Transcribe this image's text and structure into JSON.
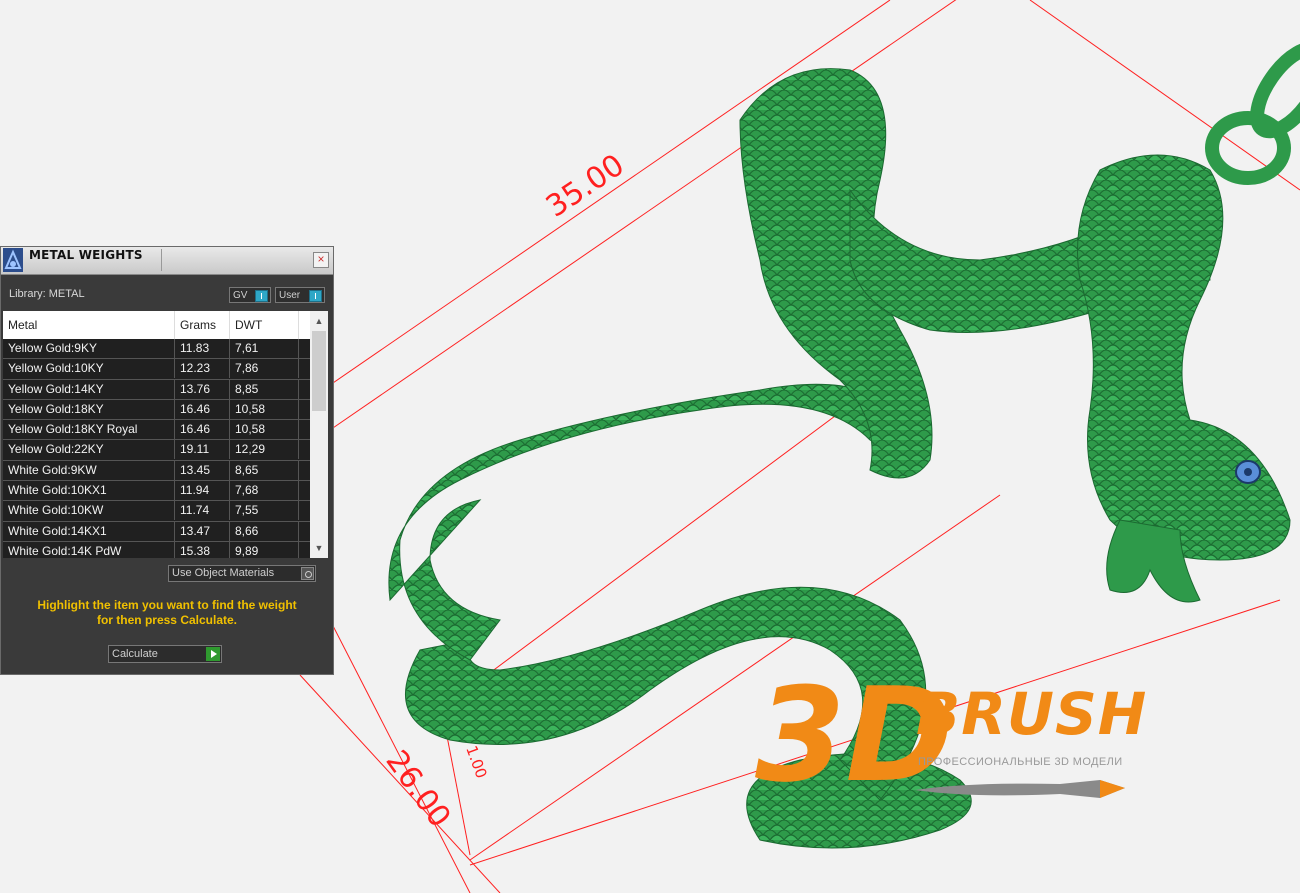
{
  "panel": {
    "title": "METAL WEIGHTS",
    "close": "×",
    "library_label": "Library: METAL",
    "toggles": {
      "gv": "GV",
      "user": "User"
    },
    "columns": [
      "Metal",
      "Grams",
      "DWT"
    ],
    "rows": [
      {
        "metal": "Yellow Gold:9KY",
        "grams": "11.83",
        "dwt": "7,61"
      },
      {
        "metal": "Yellow Gold:10KY",
        "grams": "12.23",
        "dwt": "7,86"
      },
      {
        "metal": "Yellow Gold:14KY",
        "grams": "13.76",
        "dwt": "8,85"
      },
      {
        "metal": "Yellow Gold:18KY",
        "grams": "16.46",
        "dwt": "10,58"
      },
      {
        "metal": "Yellow Gold:18KY Royal",
        "grams": "16.46",
        "dwt": "10,58"
      },
      {
        "metal": "Yellow Gold:22KY",
        "grams": "19.11",
        "dwt": "12,29"
      },
      {
        "metal": "White Gold:9KW",
        "grams": "13.45",
        "dwt": "8,65"
      },
      {
        "metal": "White Gold:10KX1",
        "grams": "11.94",
        "dwt": "7,68"
      },
      {
        "metal": "White Gold:10KW",
        "grams": "11.74",
        "dwt": "7,55"
      },
      {
        "metal": "White Gold:14KX1",
        "grams": "13.47",
        "dwt": "8,66"
      },
      {
        "metal": "White Gold:14K PdW",
        "grams": "15.38",
        "dwt": "9,89"
      }
    ],
    "use_object_materials": "Use Object Materials",
    "hint_line1": "Highlight the item you want to find the weight",
    "hint_line2": "for then press Calculate.",
    "calculate": "Calculate",
    "accent_color": "#f0c000"
  },
  "viewport": {
    "dimensions": [
      "35.00",
      "26.00",
      "1.00"
    ],
    "model_color": "#2e9a4a",
    "dimension_color": "#ff2020"
  },
  "logo": {
    "brand_3d": "3D",
    "brand": "BRUSH",
    "tagline": "ПРОФЕССИОНАЛЬНЫЕ 3D МОДЕЛИ",
    "color": "#f18a16"
  }
}
